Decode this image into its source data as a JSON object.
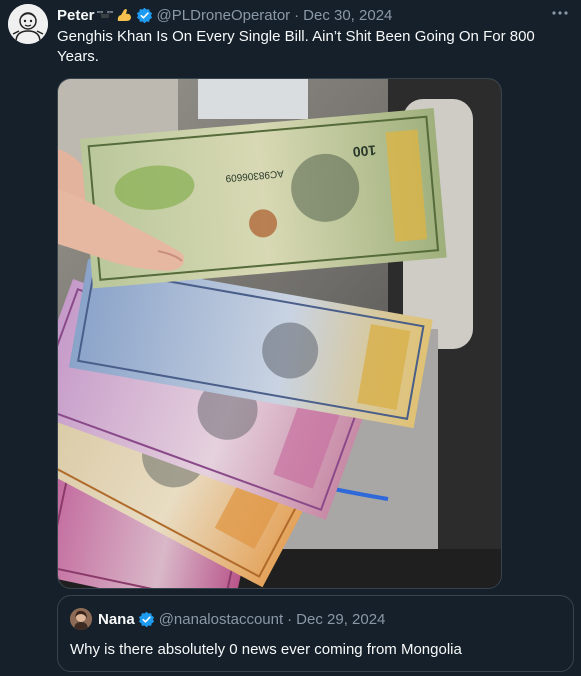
{
  "tweet": {
    "display_name": "Peter",
    "handle": "@PLDroneOperator",
    "separator": "·",
    "date": "Dec 30, 2024",
    "text": "Genghis Khan Is On Every Single Bill. Ain’t Shit Been Going On For 800 Years.",
    "name_emojis": [
      "drone-emoji",
      "bicep-emoji"
    ],
    "verified_icon": "verified-badge-icon",
    "more_icon": "more-options-icon"
  },
  "media": {
    "subject": "mongolian-banknotes-photo",
    "banknote_serial": "AC98306609",
    "banknote_value_label": "100"
  },
  "quote": {
    "display_name": "Nana",
    "handle": "@nanalostaccount",
    "separator": "·",
    "date": "Dec 29, 2024",
    "text": "Why is there absolutely 0 news ever coming from Mongolia"
  },
  "colors": {
    "background": "#15202b",
    "primary_text": "#f7f9f9",
    "secondary_text": "#8b98a5",
    "verified": "#1d9bf0",
    "border": "#38444d"
  }
}
